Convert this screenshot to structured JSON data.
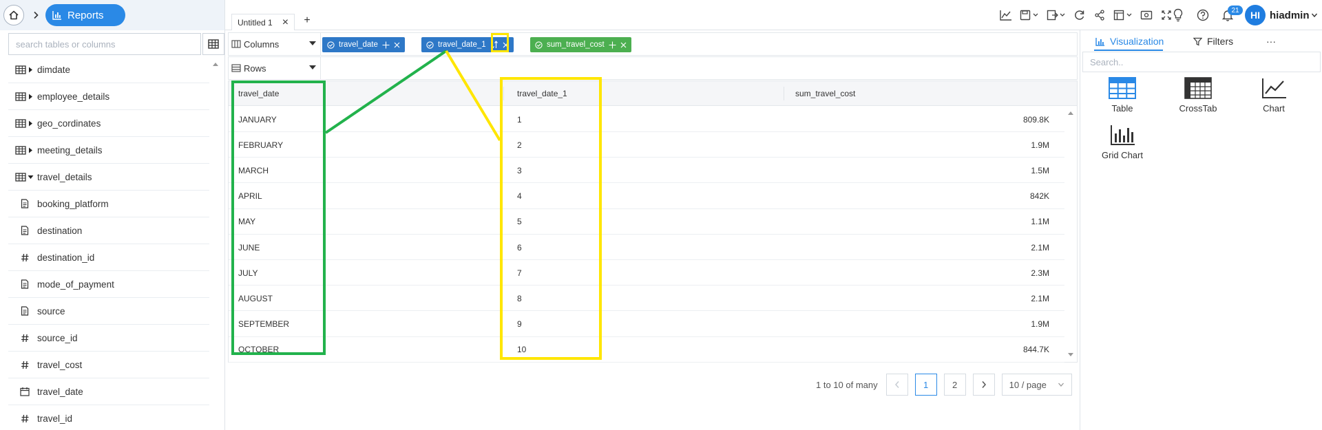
{
  "header": {
    "reports_label": "Reports",
    "tab_title": "Untitled 1",
    "tab_close": "×",
    "tab_add": "+",
    "notification_count": "21",
    "avatar_initials": "HI",
    "username": "hiadmin"
  },
  "icons": {
    "home": "home-icon",
    "chevron": "chevron-right-icon",
    "reports": "bar-chart-icon",
    "toolbar": [
      "line-chart-icon",
      "save-icon",
      "export-icon",
      "refresh-icon",
      "share-icon",
      "layout-icon",
      "preview-icon",
      "expand-icon"
    ],
    "right": [
      "lightbulb-icon",
      "help-icon",
      "bell-icon"
    ]
  },
  "left_panel": {
    "search_placeholder": "search tables or columns",
    "tree": [
      {
        "label": "dimdate",
        "type": "table",
        "expanded": false
      },
      {
        "label": "employee_details",
        "type": "table",
        "expanded": false
      },
      {
        "label": "geo_cordinates",
        "type": "table",
        "expanded": false
      },
      {
        "label": "meeting_details",
        "type": "table",
        "expanded": false
      },
      {
        "label": "travel_details",
        "type": "table",
        "expanded": true
      },
      {
        "label": "booking_platform",
        "type": "text"
      },
      {
        "label": "destination",
        "type": "text"
      },
      {
        "label": "destination_id",
        "type": "number"
      },
      {
        "label": "mode_of_payment",
        "type": "text"
      },
      {
        "label": "source",
        "type": "text"
      },
      {
        "label": "source_id",
        "type": "number"
      },
      {
        "label": "travel_cost",
        "type": "number"
      },
      {
        "label": "travel_date",
        "type": "date"
      },
      {
        "label": "travel_id",
        "type": "number"
      }
    ]
  },
  "builder": {
    "columns_label": "Columns",
    "rows_label": "Rows",
    "chips": [
      {
        "label": "travel_date",
        "color": "#2e78c7"
      },
      {
        "label": "travel_date_1",
        "color": "#2e78c7"
      },
      {
        "label": "sum_travel_cost",
        "color": "#4caf50"
      }
    ]
  },
  "table": {
    "headers": [
      "travel_date",
      "travel_date_1",
      "sum_travel_cost"
    ],
    "rows": [
      [
        "JANUARY",
        "1",
        "809.8K"
      ],
      [
        "FEBRUARY",
        "2",
        "1.9M"
      ],
      [
        "MARCH",
        "3",
        "1.5M"
      ],
      [
        "APRIL",
        "4",
        "842K"
      ],
      [
        "MAY",
        "5",
        "1.1M"
      ],
      [
        "JUNE",
        "6",
        "2.1M"
      ],
      [
        "JULY",
        "7",
        "2.3M"
      ],
      [
        "AUGUST",
        "8",
        "2.1M"
      ],
      [
        "SEPTEMBER",
        "9",
        "1.9M"
      ],
      [
        "OCTOBER",
        "10",
        "844.7K"
      ]
    ]
  },
  "pagination": {
    "summary": "1 to 10 of many",
    "pages": [
      "1",
      "2"
    ],
    "current_page": "1",
    "page_size": "10 / page"
  },
  "right_panel": {
    "tab_visualization": "Visualization",
    "tab_filters": "Filters",
    "tab_more": "···",
    "search_placeholder": "Search..",
    "visualizations": [
      "Table",
      "CrossTab",
      "Chart",
      "Grid Chart"
    ]
  },
  "colors": {
    "accent": "#2a89e6",
    "chip_blue": "#2e78c7",
    "chip_green": "#4caf50",
    "highlight_green": "#22b24c",
    "highlight_yellow": "#ffe600"
  }
}
